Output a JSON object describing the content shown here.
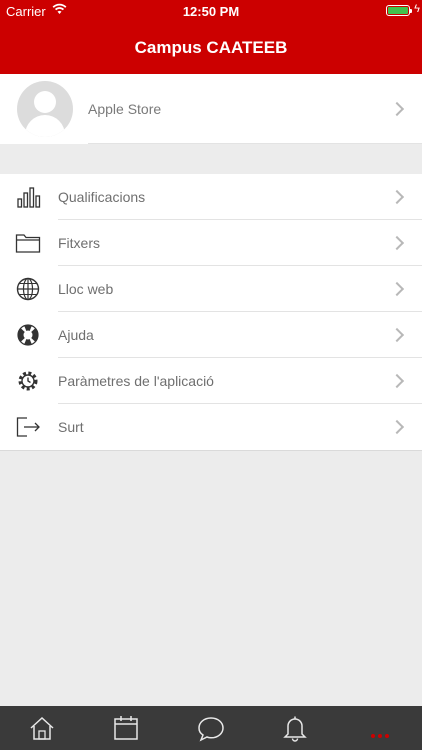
{
  "status_bar": {
    "carrier": "Carrier",
    "time": "12:50 PM"
  },
  "header": {
    "title": "Campus CAATEEB"
  },
  "user": {
    "name": "Apple Store"
  },
  "menu": [
    {
      "label": "Qualificacions",
      "icon": "bar-chart-icon"
    },
    {
      "label": "Fitxers",
      "icon": "folder-icon"
    },
    {
      "label": "Lloc web",
      "icon": "globe-icon"
    },
    {
      "label": "Ajuda",
      "icon": "lifebuoy-icon"
    },
    {
      "label": "Paràmetres de l'aplicació",
      "icon": "settings-icon"
    },
    {
      "label": "Surt",
      "icon": "logout-icon"
    }
  ],
  "tabbar": {
    "tabs": [
      "home-icon",
      "calendar-icon",
      "messages-icon",
      "notifications-icon",
      "more-icon"
    ],
    "active": "more-icon",
    "active_color": "#cc0000"
  },
  "colors": {
    "header": "#cc0000",
    "tabbar": "#3a3a3a",
    "battery": "#41c24c"
  }
}
